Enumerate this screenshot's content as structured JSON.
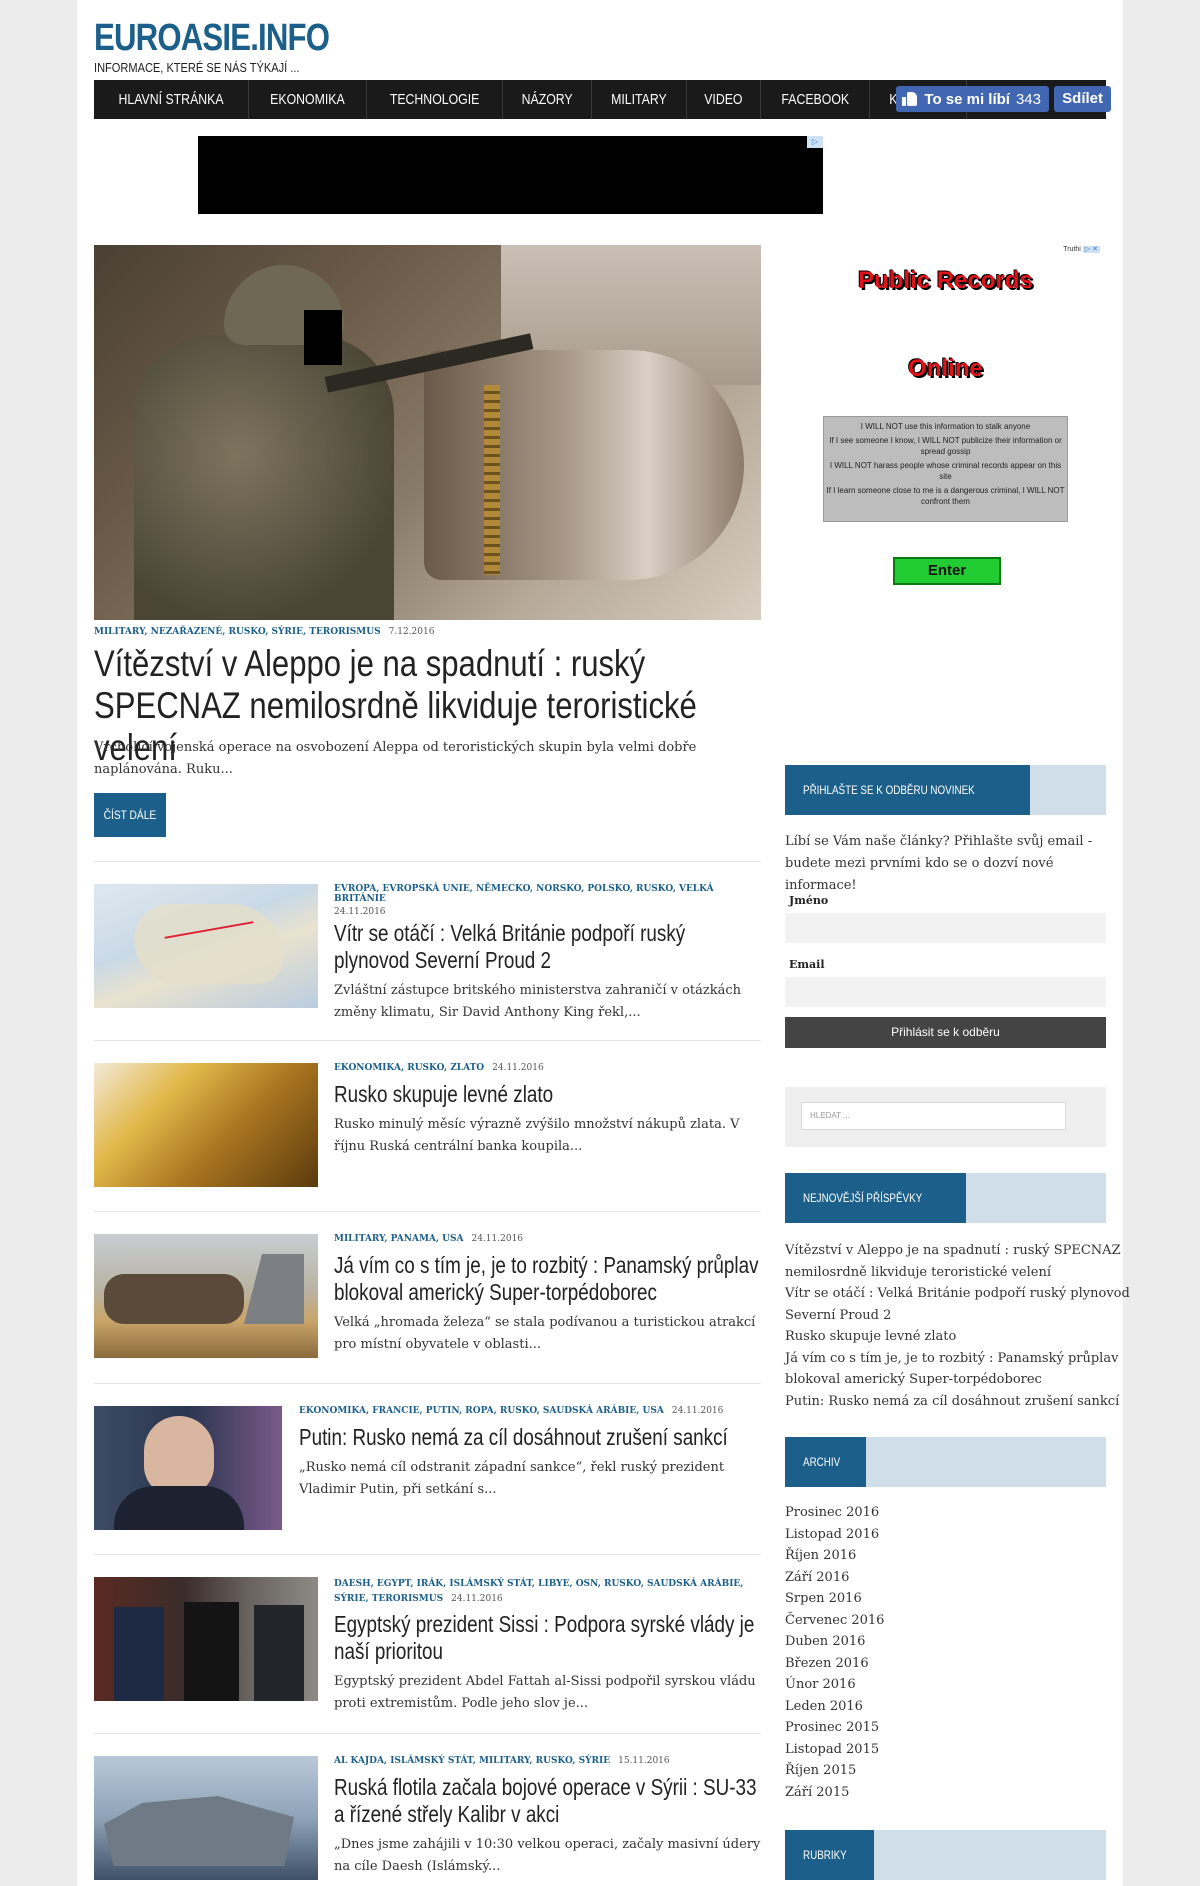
{
  "site": {
    "title": "EUROASIE.INFO",
    "tagline": "INFORMACE, KTERÉ SE NÁS TÝKAJÍ ..."
  },
  "nav": [
    "HLAVNÍ STRÁNKA",
    "EKONOMIKA",
    "TECHNOLOGIE",
    "NÁZORY",
    "MILITARY",
    "VIDEO",
    "FACEBOOK",
    "KONTAKT"
  ],
  "facebook": {
    "like_label": "To se mi líbí",
    "like_count": "343",
    "share_label": "Sdílet"
  },
  "featured": {
    "categories": "MILITARY, NEZAŘAZENÉ, RUSKO, SÝRIE, TERORISMUS",
    "date": "7.12.2016",
    "title": "Vítězství v Aleppo je na spadnutí : ruský SPECNAZ nemilosrdně likviduje teroristické velení",
    "excerpt": "Vrcholící vojenská operace na osvobození Aleppa od teroristických skupin byla velmi dobře naplánována. Ruku...",
    "read_more": "ČÍST DÁLE"
  },
  "posts": [
    {
      "categories": "EVROPA, EVROPSKÁ UNIE, NĚMECKO, NORSKO, POLSKO, RUSKO, VELKÁ BRITÁNIE",
      "date": "24.11.2016",
      "title": "Vítr se otáčí : Velká Británie podpoří ruský plynovod Severní Proud 2",
      "excerpt": "Zvláštní zástupce britského ministerstva zahraničí v otázkách změny klimatu, Sir David Anthony King řekl,..."
    },
    {
      "categories": "EKONOMIKA, RUSKO, ZLATO",
      "date": "24.11.2016",
      "title": "Rusko skupuje levné zlato",
      "excerpt": "Rusko minulý měsíc výrazně zvýšilo množství nákupů zlata. V říjnu Ruská centrální banka koupila..."
    },
    {
      "categories": "MILITARY, PANAMA, USA",
      "date": "24.11.2016",
      "title": "Já vím co s tím je, je to rozbitý : Panamský průplav blokoval americký Super-torpédoborec",
      "excerpt": "Velká „hromada železa“ se stala podívanou a turistickou atrakcí pro místní obyvatele v oblasti..."
    },
    {
      "categories": "EKONOMIKA, FRANCIE, PUTIN, ROPA, RUSKO, SAUDSKÁ ARÁBIE, USA",
      "date": "24.11.2016",
      "title": "Putin: Rusko nemá za cíl dosáhnout zrušení sankcí",
      "excerpt": "„Rusko nemá cíl odstranit západní sankce“, řekl ruský prezident Vladimir Putin, při setkání s..."
    },
    {
      "categories": "DAESH, EGYPT, IRÁK, ISLÁMSKÝ STÁT, LIBYE, OSN, RUSKO, SAUDSKÁ ARÁBIE, SÝRIE, TERORISMUS",
      "date": "24.11.2016",
      "title": "Egyptský prezident Sissi : Podpora syrské vlády je naší prioritou",
      "excerpt": "Egyptský prezident Abdel Fattah al-Sissi podpořil syrskou vládu proti extremistům. Podle jeho slov je..."
    },
    {
      "categories": "AL KAJDA, ISLÁMSKÝ STÁT, MILITARY, RUSKO, SÝRIE",
      "date": "15.11.2016",
      "title": "Ruská flotila začala bojové operace v Sýrii : SU-33 a řízené střely Kalibr v akci",
      "excerpt": "„Dnes jsme zahájili v 10:30 velkou operaci, začaly masivní údery na cíle Daesh (Islámský..."
    }
  ],
  "side_ad": {
    "brand": "Truthi",
    "title1": "Public Records",
    "title2": "Online",
    "lines": [
      "I WILL NOT use this information to stalk anyone",
      "If I see someone I know, I WILL NOT publicize their information or spread gossip",
      "I WILL NOT harass people whose criminal records appear on this site",
      "If I learn someone close to me is a dangerous criminal, I WILL NOT confront them"
    ],
    "enter": "Enter"
  },
  "subscribe": {
    "heading": "PŘIHLAŠTE SE K ODBĚRU NOVINEK",
    "text": "Líbí se Vám naše články? Přihlašte svůj email - budete mezi prvními kdo se o dozví nové informace!",
    "name_label": "Jméno",
    "email_label": "Email",
    "button": "Přihlásit se k odběru"
  },
  "search": {
    "placeholder": "HLEDAT ..."
  },
  "recent": {
    "heading": "NEJNOVĚJŠÍ PŘÍSPĚVKY",
    "lines": [
      "Vítězství v Aleppo je na spadnutí : ruský SPECNAZ",
      "nemilosrdně likviduje teroristické velení",
      "Vítr se otáčí : Velká Británie podpoří ruský plynovod",
      "Severní Proud 2",
      "Rusko skupuje levné zlato",
      "Já vím co s tím je, je to rozbitý : Panamský průplav",
      "blokoval americký Super-torpédoborec",
      "Putin: Rusko nemá za cíl dosáhnout zrušení sankcí"
    ]
  },
  "archive": {
    "heading": "ARCHIV",
    "items": [
      "Prosinec 2016",
      "Listopad 2016",
      "Říjen 2016",
      "Září 2016",
      "Srpen 2016",
      "Červenec 2016",
      "Duben 2016",
      "Březen 2016",
      "Únor 2016",
      "Leden 2016",
      "Prosinec 2015",
      "Listopad 2015",
      "Říjen 2015",
      "Září 2015"
    ]
  },
  "categories_widget": {
    "heading": "RUBRIKY"
  },
  "colors": {
    "accent": "#1b5f8a",
    "nav_bg": "#1a1a1a",
    "widget_band": "#cfdee9",
    "facebook": "#4267b2"
  }
}
